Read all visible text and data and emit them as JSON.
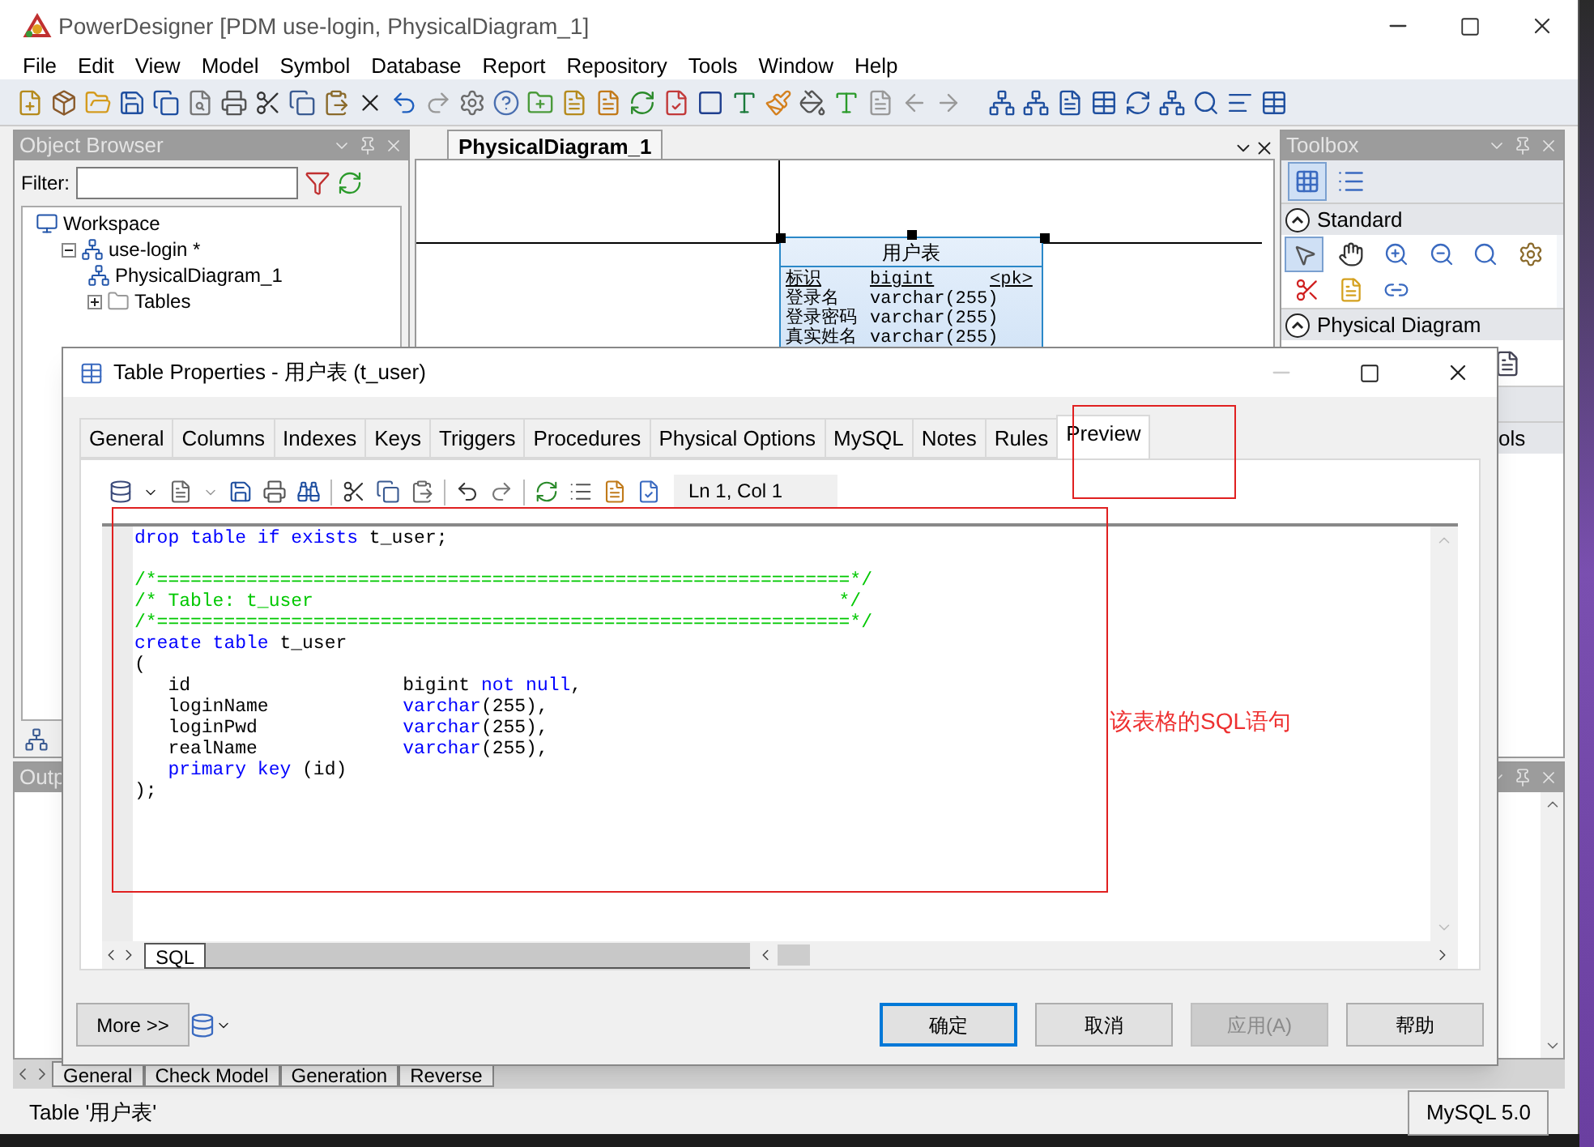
{
  "window": {
    "title": "PowerDesigner [PDM use-login, PhysicalDiagram_1]"
  },
  "menu": [
    "File",
    "Edit",
    "View",
    "Model",
    "Symbol",
    "Database",
    "Report",
    "Repository",
    "Tools",
    "Window",
    "Help"
  ],
  "object_browser": {
    "title": "Object Browser",
    "filter_label": "Filter:",
    "tree": [
      {
        "label": "Workspace",
        "kind": "workspace",
        "children": [
          {
            "label": "use-login *",
            "kind": "model",
            "expanded": true,
            "children": [
              {
                "label": "PhysicalDiagram_1",
                "kind": "diagram"
              },
              {
                "label": "Tables",
                "kind": "folder",
                "expanded": false
              }
            ]
          }
        ]
      }
    ]
  },
  "diagram": {
    "tab": "PhysicalDiagram_1",
    "table": {
      "name": "用户表",
      "columns": [
        {
          "name": "标识",
          "type": "bigint",
          "key": "<pk>"
        },
        {
          "name": "登录名",
          "type": "varchar(255)"
        },
        {
          "name": "登录密码",
          "type": "varchar(255)"
        },
        {
          "name": "真实姓名",
          "type": "varchar(255)"
        }
      ]
    }
  },
  "toolbox": {
    "title": "Toolbox",
    "sections": [
      {
        "label": "Standard"
      },
      {
        "label": "Physical Diagram"
      },
      {
        "label": "ols"
      }
    ]
  },
  "output": {
    "title": "Outp"
  },
  "bottom_tabs": [
    {
      "label": "General"
    },
    {
      "label": "Check Model"
    },
    {
      "label": "Generation"
    },
    {
      "label": "Reverse"
    }
  ],
  "status_bar": {
    "text": "Table '用户表'",
    "dbms": "MySQL 5.0"
  },
  "dialog": {
    "title": "Table Properties - 用户表 (t_user)",
    "tabs": [
      {
        "label": "General",
        "selected": false
      },
      {
        "label": "Columns",
        "selected": false
      },
      {
        "label": "Indexes",
        "selected": false
      },
      {
        "label": "Keys",
        "selected": false
      },
      {
        "label": "Triggers",
        "selected": false
      },
      {
        "label": "Procedures",
        "selected": false
      },
      {
        "label": "Physical Options",
        "selected": false
      },
      {
        "label": "MySQL",
        "selected": false
      },
      {
        "label": "Notes",
        "selected": false
      },
      {
        "label": "Rules",
        "selected": false
      },
      {
        "label": "Preview",
        "selected": true
      }
    ],
    "cursor_position": "Ln 1, Col 1",
    "code_lines": [
      {
        "segments": [
          {
            "text": "drop table if exists",
            "kind": "keyword"
          },
          {
            "text": " t_user;",
            "kind": "plain"
          }
        ]
      },
      {
        "space_before": true,
        "segments": [
          {
            "text": "/*==============================================================*/",
            "kind": "comment"
          }
        ]
      },
      {
        "segments": [
          {
            "text": "/* Table: t_user                                               */",
            "kind": "comment"
          }
        ]
      },
      {
        "segments": [
          {
            "text": "/*==============================================================*/",
            "kind": "comment"
          }
        ]
      },
      {
        "segments": [
          {
            "text": "create table",
            "kind": "keyword"
          },
          {
            "text": " t_user",
            "kind": "plain"
          }
        ]
      },
      {
        "segments": [
          {
            "text": "(",
            "kind": "plain"
          }
        ]
      },
      {
        "segments": [
          {
            "text": "   id                   bigint ",
            "kind": "plain"
          },
          {
            "text": "not null",
            "kind": "keyword"
          },
          {
            "text": ",",
            "kind": "plain"
          }
        ]
      },
      {
        "segments": [
          {
            "text": "   loginName            ",
            "kind": "plain"
          },
          {
            "text": "varchar",
            "kind": "keyword"
          },
          {
            "text": "(255),",
            "kind": "plain"
          }
        ]
      },
      {
        "segments": [
          {
            "text": "   loginPwd             ",
            "kind": "plain"
          },
          {
            "text": "varchar",
            "kind": "keyword"
          },
          {
            "text": "(255),",
            "kind": "plain"
          }
        ]
      },
      {
        "segments": [
          {
            "text": "   realName             ",
            "kind": "plain"
          },
          {
            "text": "varchar",
            "kind": "keyword"
          },
          {
            "text": "(255),",
            "kind": "plain"
          }
        ]
      },
      {
        "segments": [
          {
            "text": "   primary key",
            "kind": "keyword"
          },
          {
            "text": " (id)",
            "kind": "plain"
          }
        ]
      },
      {
        "segments": [
          {
            "text": ");",
            "kind": "plain"
          }
        ]
      }
    ],
    "editor_tabs": [
      {
        "label": "SQL",
        "selected": true
      }
    ],
    "more_button": "More >>",
    "buttons": [
      {
        "label": "确定",
        "default": true,
        "disabled": false
      },
      {
        "label": "取消",
        "default": false,
        "disabled": false
      },
      {
        "label": "应用(A)",
        "default": false,
        "disabled": true
      },
      {
        "label": "帮助",
        "default": false,
        "disabled": false
      }
    ],
    "annotation": {
      "label": "该表格的SQL语句"
    }
  }
}
